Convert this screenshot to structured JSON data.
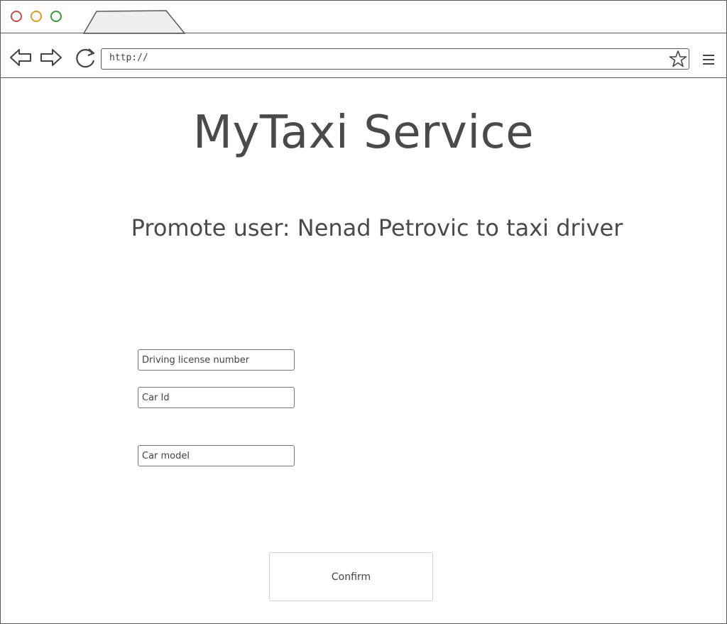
{
  "browser": {
    "address": "http://",
    "icons": {
      "back": "back-arrow-icon",
      "forward": "forward-arrow-icon",
      "reload": "reload-icon",
      "bookmark": "star-icon",
      "menu": "hamburger-menu-icon"
    },
    "colors": {
      "close": "#c0504d",
      "minimize": "#d89a2a",
      "maximize": "#3a9a3a"
    }
  },
  "page": {
    "title": "MyTaxi Service",
    "subtitle": "Promote user: Nenad Petrovic to taxi driver"
  },
  "form": {
    "license": {
      "placeholder": "Driving license number",
      "value": ""
    },
    "car_id": {
      "placeholder": "Car Id",
      "value": ""
    },
    "car_model": {
      "placeholder": "Car model",
      "value": ""
    },
    "confirm_label": "Confirm"
  }
}
